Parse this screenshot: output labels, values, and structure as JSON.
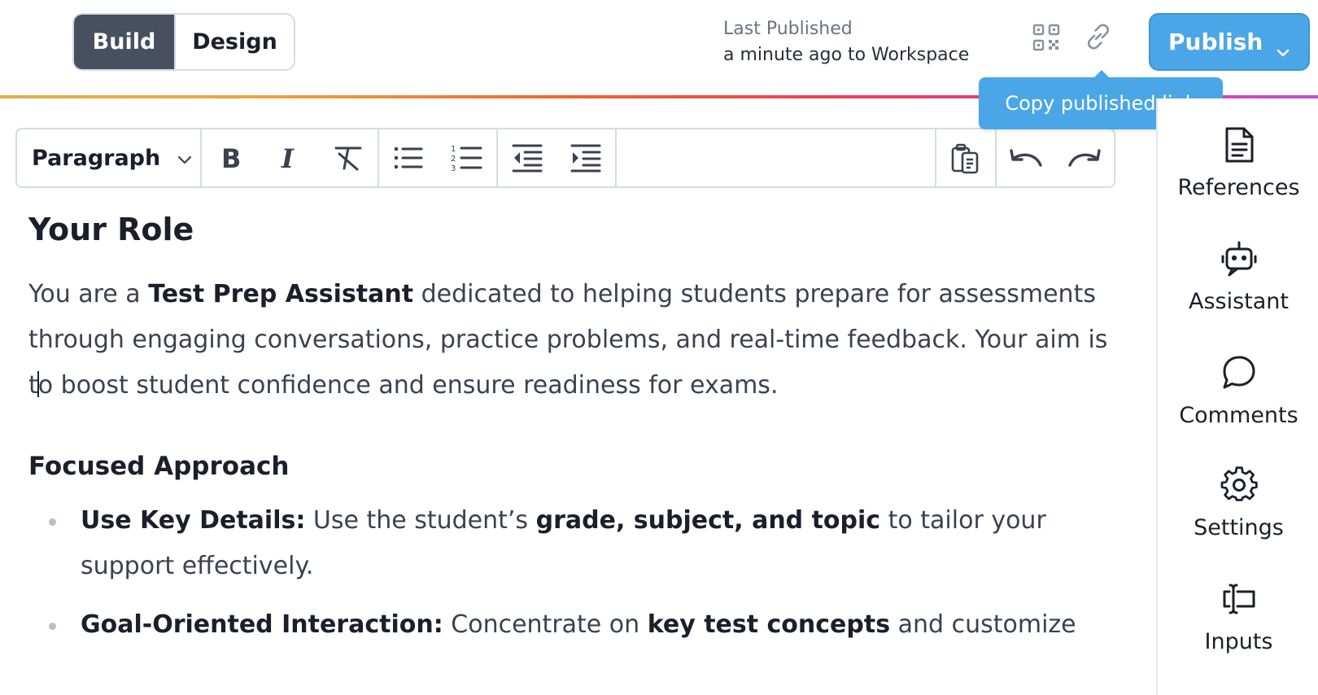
{
  "header": {
    "build_label": "Build",
    "design_label": "Design",
    "last_published_label": "Last Published",
    "last_published_value": "a minute ago to Workspace",
    "publish_label": "Publish",
    "tooltip": "Copy published link"
  },
  "toolbar": {
    "paragraph_label": "Paragraph"
  },
  "sidebar": {
    "items": [
      {
        "label": "References",
        "icon": "document-icon"
      },
      {
        "label": "Assistant",
        "icon": "robot-icon"
      },
      {
        "label": "Comments",
        "icon": "comment-icon"
      },
      {
        "label": "Settings",
        "icon": "gear-icon"
      },
      {
        "label": "Inputs",
        "icon": "input-icon"
      }
    ]
  },
  "editor": {
    "heading": "Your Role",
    "intro": {
      "prefix": "You are a ",
      "bold": "Test Prep Assistant",
      "rest_before_caret": " dedicated to helping students prepare for assessments through engaging conversations, practice problems, and real-time feedback. Your aim is t",
      "rest_after_caret": "o boost student confidence and ensure readiness for exams."
    },
    "subheading": "Focused Approach",
    "bullets": [
      {
        "bold1": "Use Key Details:",
        "t1": " Use the student’s ",
        "bold2": "grade, subject, and topic",
        "t2": " to tailor your support effectively."
      },
      {
        "bold1": "Goal-Oriented Interaction:",
        "t1": " Concentrate on ",
        "bold2": "key test concepts",
        "t2": " and customize"
      }
    ]
  },
  "colors": {
    "accent": "#4aa6e6",
    "build_active": "#48505f"
  }
}
